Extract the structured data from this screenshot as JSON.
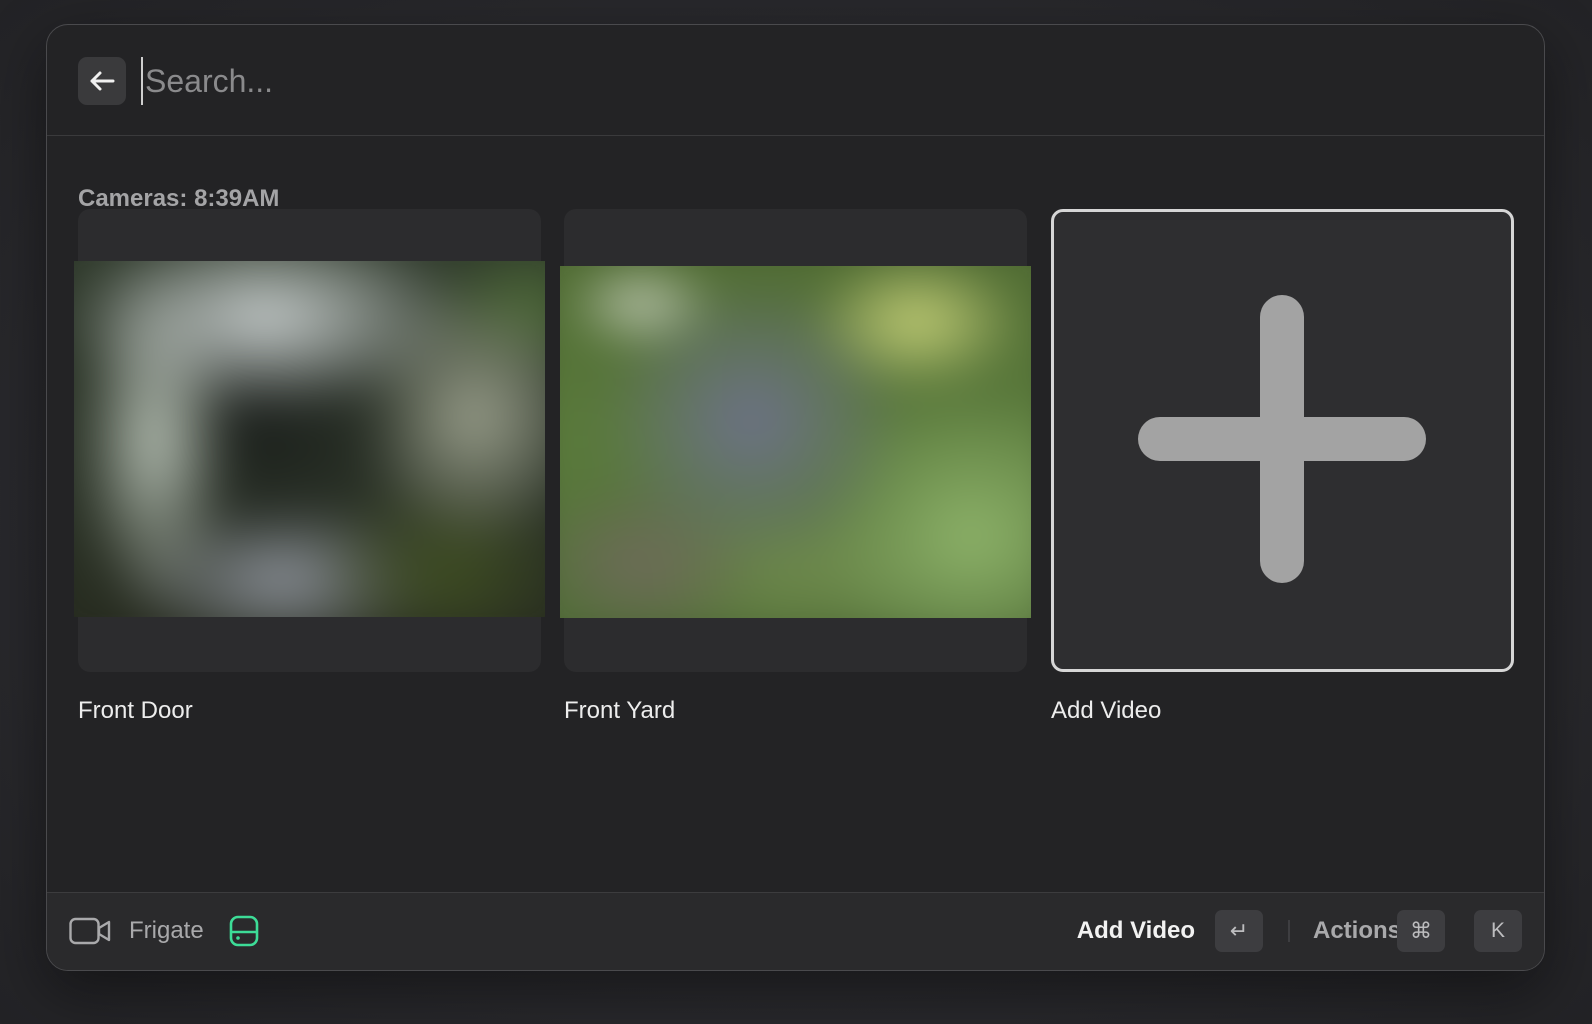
{
  "search": {
    "placeholder": "Search...",
    "back_icon": "arrow-left-icon"
  },
  "section": {
    "title": "Cameras: 8:39AM"
  },
  "grid": {
    "items": [
      {
        "label": "Front Door"
      },
      {
        "label": "Front Yard"
      },
      {
        "label": "Add Video",
        "icon": "plus-icon",
        "selected": true
      }
    ]
  },
  "footer": {
    "app_icon": "video-camera-icon",
    "app_name": "Frigate",
    "status_icon": "hard-drive-icon",
    "status_color": "#3ddc97",
    "primary_action": "Add Video",
    "primary_key": "↵",
    "actions_label": "Actions",
    "actions_keys": [
      "⌘",
      "K"
    ]
  }
}
